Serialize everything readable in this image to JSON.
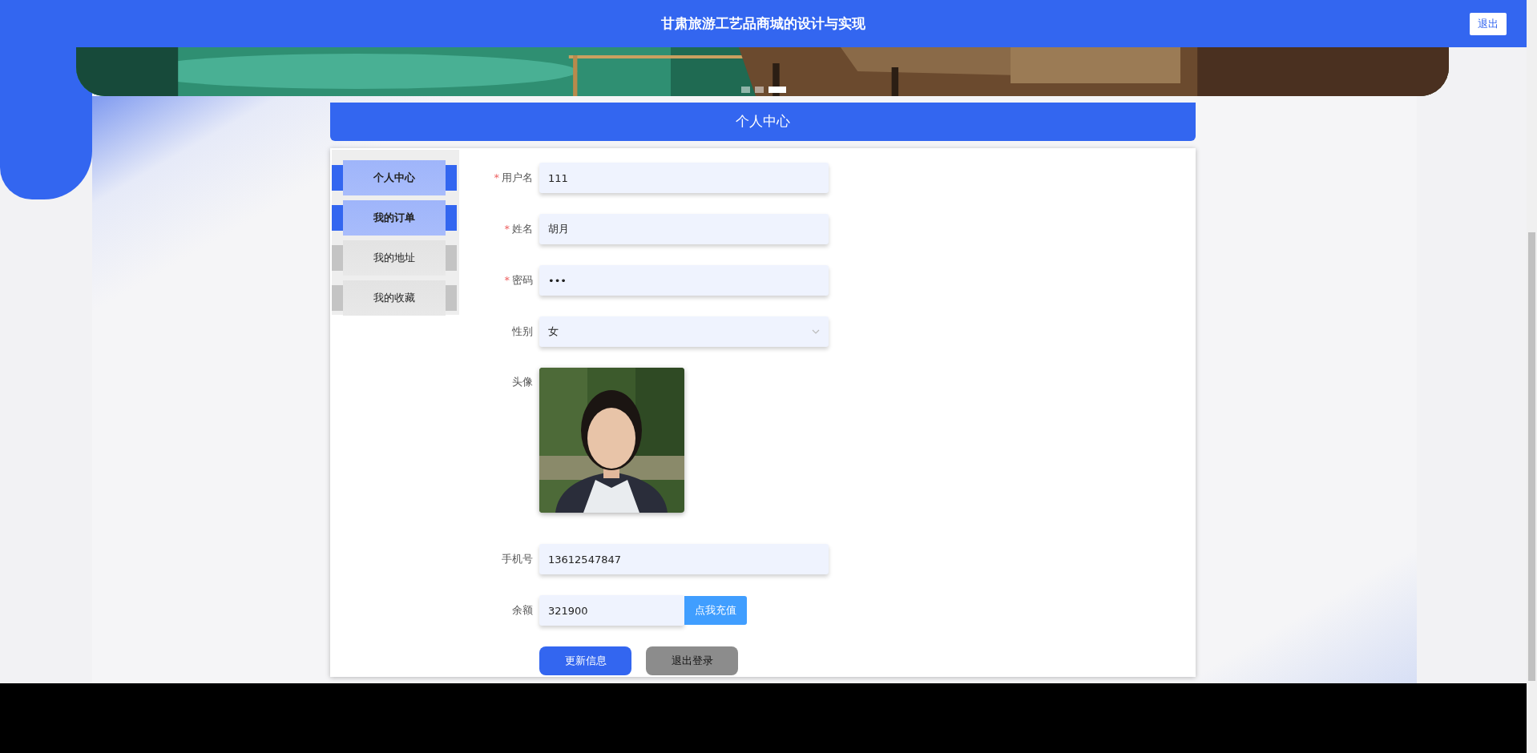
{
  "header": {
    "title": "甘肃旅游工艺品商城的设计与实现",
    "logout_button": "退出"
  },
  "banner": {
    "kind": "picture",
    "dots": [
      {
        "selected": false
      },
      {
        "selected": false
      },
      {
        "selected": true
      }
    ]
  },
  "page_title": "个人中心",
  "sidebar": {
    "items": [
      {
        "label": "个人中心",
        "selected": true
      },
      {
        "label": "我的订单",
        "selected": true
      },
      {
        "label": "我的地址",
        "selected": false
      },
      {
        "label": "我的收藏",
        "selected": false
      }
    ]
  },
  "form": {
    "fields": [
      {
        "kind": "text",
        "required_mark": "*",
        "label": "用户名",
        "value": "111"
      },
      {
        "kind": "text",
        "required_mark": "*",
        "label": "姓名",
        "value": "胡月"
      },
      {
        "kind": "text",
        "required_mark": "*",
        "label": "密码",
        "value": "•••"
      },
      {
        "kind": "select",
        "label": "性别",
        "value": "女"
      },
      {
        "label": "头像"
      },
      {
        "kind": "text",
        "label": "手机号",
        "value": "13612547847"
      },
      {
        "kind": "recharge",
        "label": "余额",
        "value": "321900",
        "button": "点我充值"
      }
    ],
    "buttons": [
      {
        "label": "更新信息",
        "kind": "primary"
      },
      {
        "label": "退出登录",
        "kind": "secondary"
      }
    ]
  }
}
